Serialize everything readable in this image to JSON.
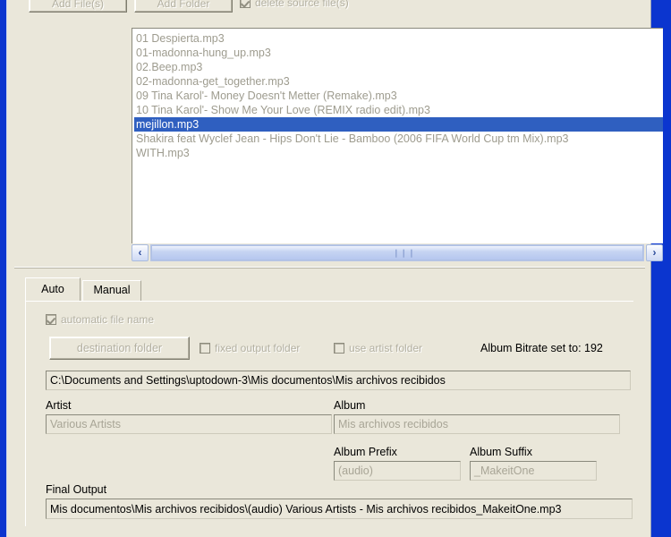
{
  "window": {
    "frame_color": "#0b35cf",
    "background": "#eae7da"
  },
  "toolbar": {
    "add_files_label": "Add File(s)",
    "add_folder_label": "Add Folder",
    "delete_source_label": "delete source file(s)",
    "delete_source_checked": true
  },
  "file_list": {
    "items": [
      {
        "name": "01 Despierta.mp3",
        "selected": false
      },
      {
        "name": "01-madonna-hung_up.mp3",
        "selected": false
      },
      {
        "name": "02.Beep.mp3",
        "selected": false
      },
      {
        "name": "02-madonna-get_together.mp3",
        "selected": false
      },
      {
        "name": "09 Tina Karol'- Money Doesn't Metter (Remake).mp3",
        "selected": false
      },
      {
        "name": "10 Tina Karol'- Show Me Your Love (REMIX radio edit).mp3",
        "selected": false
      },
      {
        "name": "mejillon.mp3",
        "selected": true
      },
      {
        "name": "Shakira feat Wyclef Jean - Hips Don't Lie - Bamboo (2006 FIFA World Cup tm Mix).mp3",
        "selected": false
      },
      {
        "name": "WITH.mp3",
        "selected": false
      }
    ],
    "selection_color": "#2f5fc0",
    "scrollbar": {
      "left_arrow": "‹",
      "right_arrow": "›",
      "grip": "❙❙❙"
    }
  },
  "tabs": [
    {
      "label": "Auto",
      "active": true
    },
    {
      "label": "Manual",
      "active": false
    }
  ],
  "auto_tab": {
    "automatic_file_name_label": "automatic file name",
    "automatic_file_name_checked": true,
    "destination_folder_label": "destination folder",
    "fixed_output_folder_label": "fixed output folder",
    "fixed_output_folder_checked": false,
    "use_artist_folder_label": "use artist folder",
    "use_artist_folder_checked": false,
    "album_bitrate_label": "Album Bitrate set to: 192",
    "path_value": "C:\\Documents and Settings\\uptodown-3\\Mis documentos\\Mis archivos recibidos",
    "artist_label": "Artist",
    "artist_value": "Various Artists",
    "album_label": "Album",
    "album_value": "Mis archivos recibidos",
    "album_prefix_label": "Album Prefix",
    "album_prefix_value": "(audio)",
    "album_suffix_label": "Album Suffix",
    "album_suffix_value": "_MakeitOne",
    "final_output_label": "Final Output",
    "final_output_value": "Mis documentos\\Mis archivos recibidos\\(audio) Various Artists - Mis archivos recibidos_MakeitOne.mp3"
  }
}
